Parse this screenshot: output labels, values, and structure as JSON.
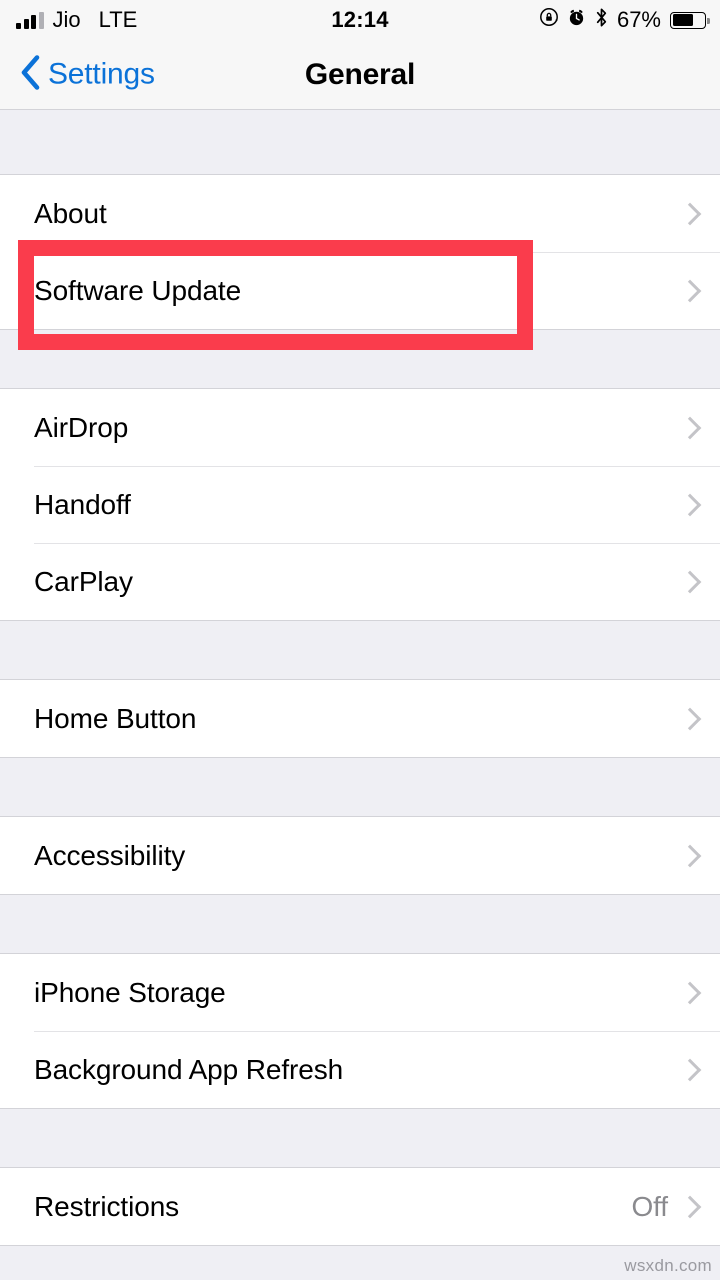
{
  "status_bar": {
    "carrier": "Jio",
    "network": "LTE",
    "time": "12:14",
    "battery_percent": "67%",
    "battery_level": 67,
    "icons": [
      "signal-bars-icon",
      "rotation-lock-icon",
      "alarm-clock-icon",
      "bluetooth-icon",
      "battery-icon"
    ]
  },
  "nav": {
    "back_label": "Settings",
    "title": "General"
  },
  "groups": [
    {
      "rows": [
        {
          "label": "About",
          "value": "",
          "accessory": "chevron"
        },
        {
          "label": "Software Update",
          "value": "",
          "accessory": "chevron"
        }
      ]
    },
    {
      "rows": [
        {
          "label": "AirDrop",
          "value": "",
          "accessory": "chevron"
        },
        {
          "label": "Handoff",
          "value": "",
          "accessory": "chevron"
        },
        {
          "label": "CarPlay",
          "value": "",
          "accessory": "chevron"
        }
      ]
    },
    {
      "rows": [
        {
          "label": "Home Button",
          "value": "",
          "accessory": "chevron"
        }
      ]
    },
    {
      "rows": [
        {
          "label": "Accessibility",
          "value": "",
          "accessory": "chevron"
        }
      ]
    },
    {
      "rows": [
        {
          "label": "iPhone Storage",
          "value": "",
          "accessory": "chevron"
        },
        {
          "label": "Background App Refresh",
          "value": "",
          "accessory": "chevron"
        }
      ]
    },
    {
      "rows": [
        {
          "label": "Restrictions",
          "value": "Off",
          "accessory": "chevron"
        }
      ]
    }
  ],
  "annotation": {
    "target_label": "Software Update",
    "color": "#FA3C4C"
  },
  "watermark": "wsxdn.com",
  "colors": {
    "accent_blue": "#0B72D8",
    "group_background": "#EFEFF4",
    "row_background": "#FFFFFF",
    "separator": "#E3E3E6",
    "chevron": "#C4C4C8",
    "value_text": "#8A8A8E",
    "annotation_red": "#FA3C4C"
  }
}
